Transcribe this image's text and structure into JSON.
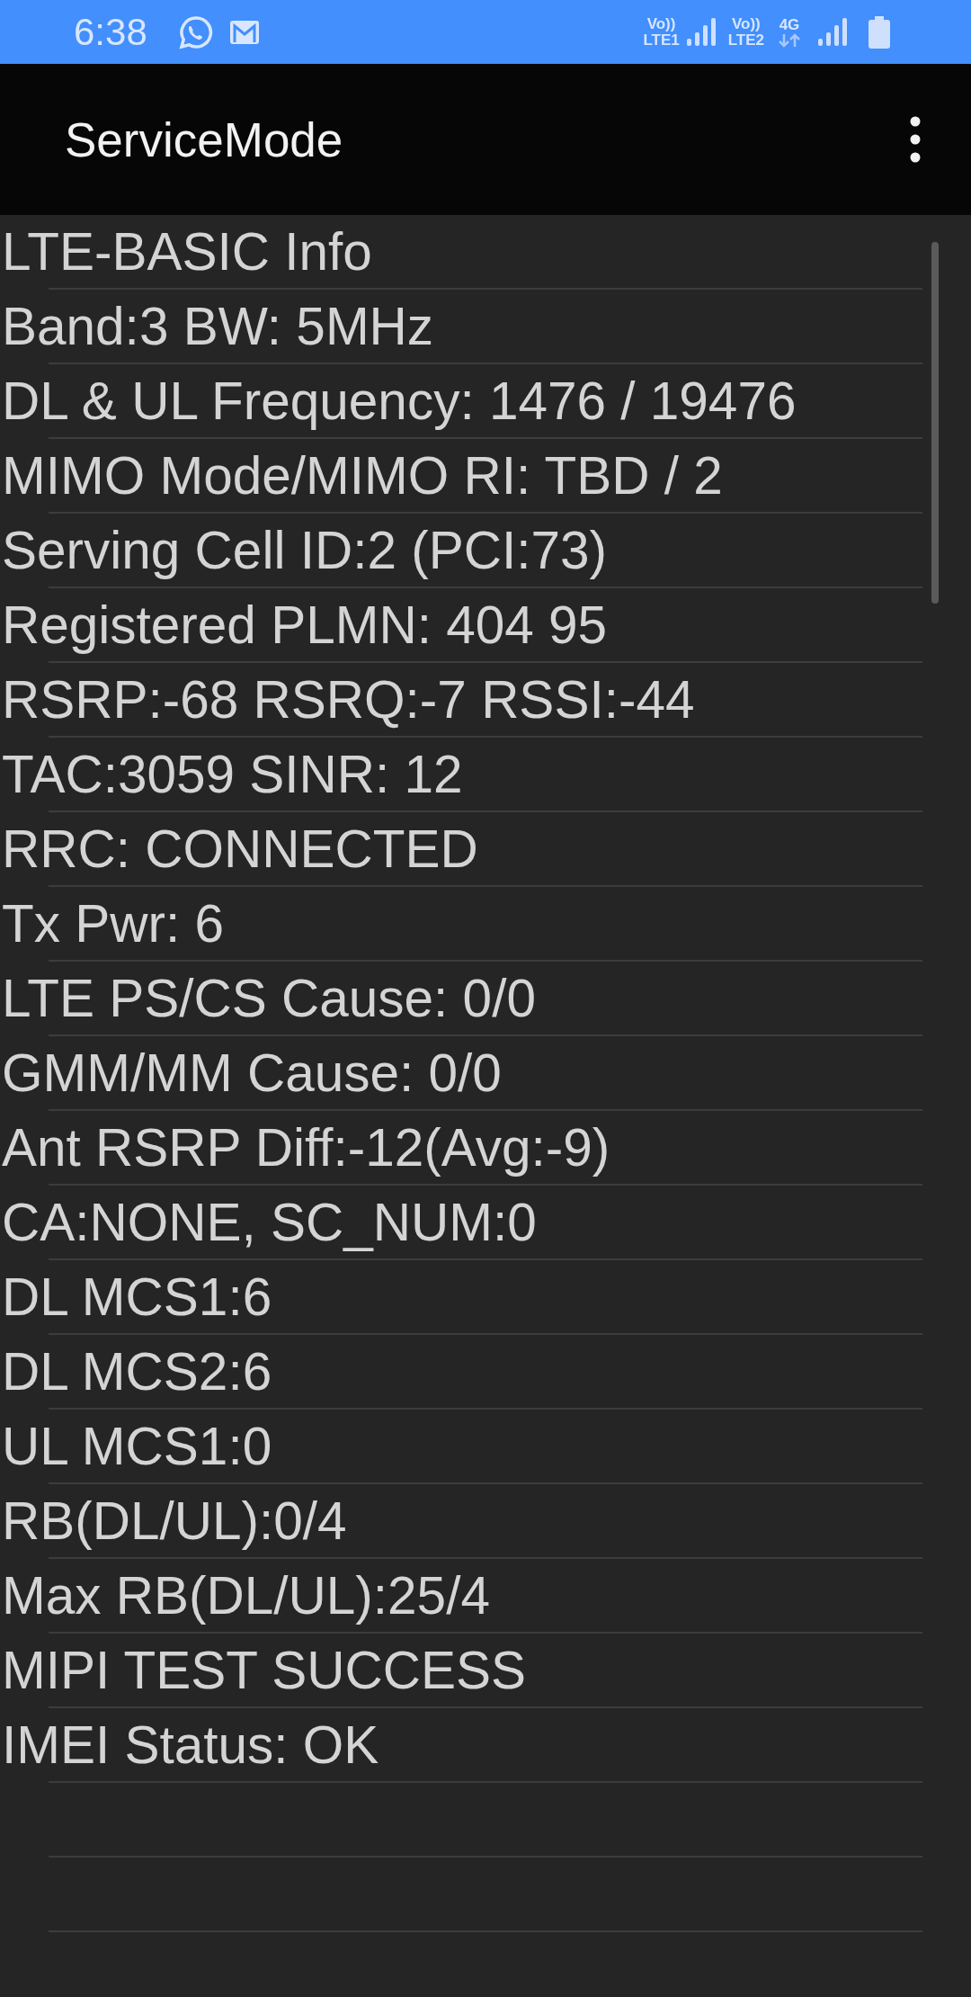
{
  "status_bar": {
    "time": "6:38",
    "sim1": {
      "volte": "Vo))",
      "network": "LTE1"
    },
    "sim2": {
      "volte": "Vo))",
      "network": "LTE2",
      "data": "4G"
    }
  },
  "app_bar": {
    "title": "ServiceMode"
  },
  "info_lines": [
    "LTE-BASIC Info",
    "Band:3 BW: 5MHz",
    "DL & UL Frequency: 1476 / 19476",
    "MIMO Mode/MIMO RI: TBD / 2",
    "Serving Cell ID:2 (PCI:73)",
    "Registered PLMN: 404 95",
    "RSRP:-68 RSRQ:-7 RSSI:-44",
    "TAC:3059 SINR: 12",
    "RRC: CONNECTED",
    "Tx Pwr: 6",
    "LTE PS/CS Cause: 0/0",
    "GMM/MM Cause: 0/0",
    "Ant RSRP Diff:-12(Avg:-9)",
    "CA:NONE, SC_NUM:0",
    "DL MCS1:6",
    "DL MCS2:6",
    "UL MCS1:0",
    "RB(DL/UL):0/4",
    "Max RB(DL/UL):25/4",
    "MIPI TEST SUCCESS",
    "IMEI Status: OK"
  ]
}
